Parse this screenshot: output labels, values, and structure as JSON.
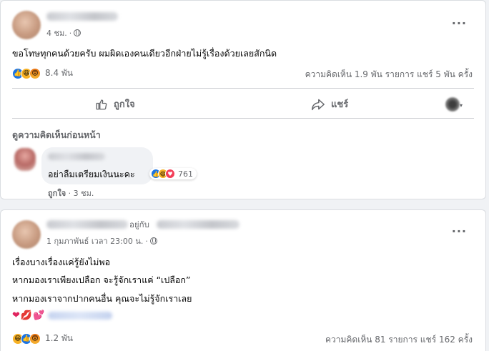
{
  "post1": {
    "time": "4 ชม.",
    "text": "ขอโทษทุกคนด้วยครับ ผมผิดเองคนเดียวอีกฝ่ายไม่รู้เรื่องด้วยเลยสักนิด",
    "reaction_count": "8.4 พัน",
    "stats": "ความคิดเห็น 1.9 พัน รายการ  แชร์ 5 พัน ครั้ง",
    "like_label": "ถูกใจ",
    "share_label": "แชร์",
    "previous_comments": "ดูความคิดเห็นก่อนหน้า",
    "comment": {
      "text": "อย่าลืมเตรียมเงินนะคะ",
      "reaction_count": "761",
      "like_label": "ถูกใจ",
      "time": "3 ชม."
    }
  },
  "post2": {
    "with_text": "อยู่กับ",
    "time": "1 กุมภาพันธ์ เวลา 23:00 น.",
    "lines": [
      "เรื่องบางเรื่องแค่รู้ยังไม่พอ",
      "หากมองเราเพียงเปลือก จะรู้จักเราแค่ “เปลือก”",
      "หากมองเราจากปากคนอื่น คุณจะไม่รู้จักเราเลย"
    ],
    "reaction_count": "1.2 พัน",
    "stats": "ความคิดเห็น 81 รายการ  แชร์ 162 ครั้ง"
  }
}
